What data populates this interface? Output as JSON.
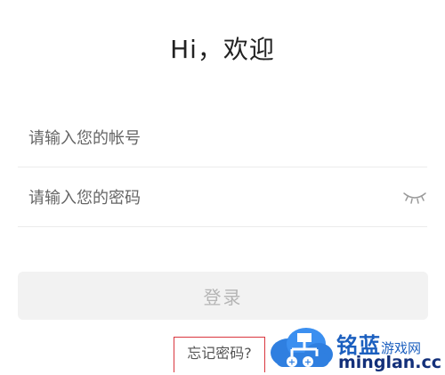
{
  "header": {
    "greeting": "Hi，欢迎"
  },
  "login_form": {
    "account_placeholder": "请输入您的帐号",
    "account_value": "",
    "password_placeholder": "请输入您的密码",
    "password_value": "",
    "password_toggle_icon": "eye-closed-icon",
    "login_label": "登录",
    "login_enabled": false,
    "forgot_label": "忘记密码?"
  },
  "colors": {
    "button_bg_disabled": "#f2f2f2",
    "button_text_disabled": "#b5b5b5",
    "highlight_box": "#d9363e"
  },
  "watermark": {
    "name": "铭蓝",
    "tagline": "游戏网",
    "domain": "minglan.cc"
  }
}
